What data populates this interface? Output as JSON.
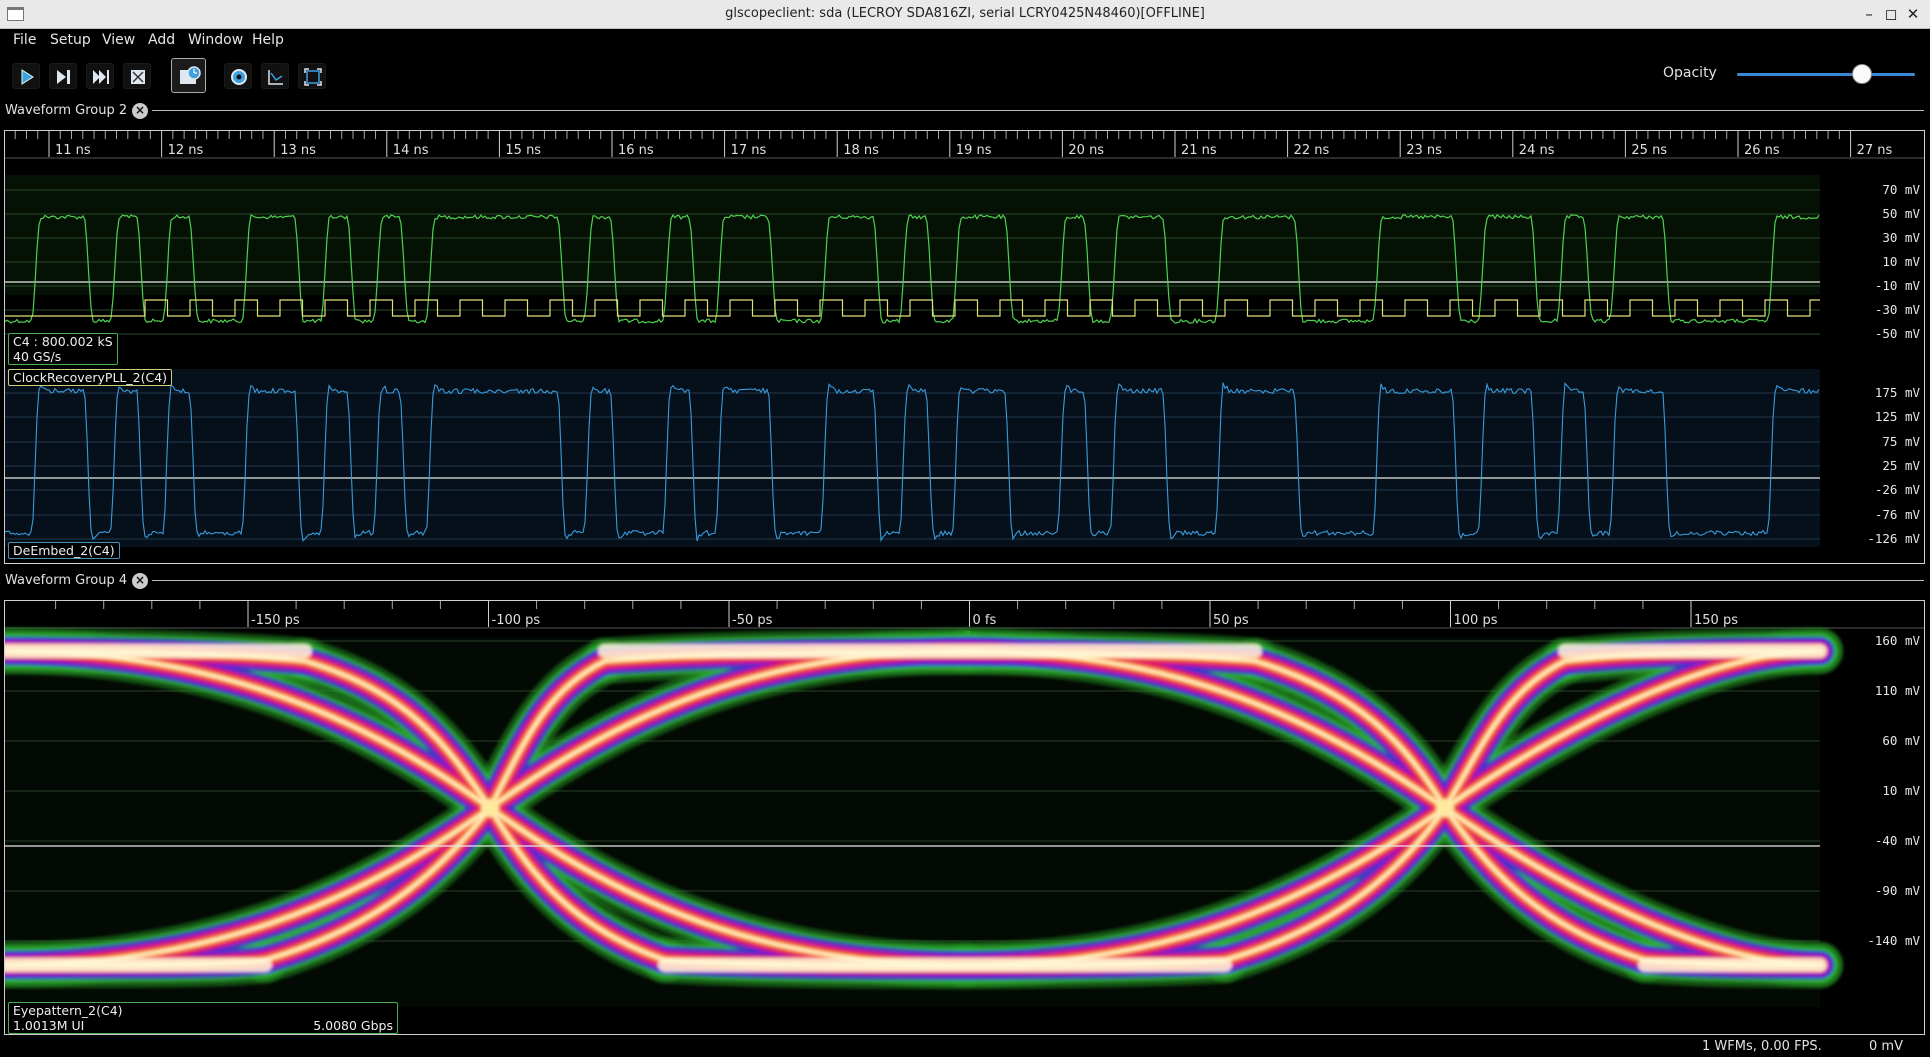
{
  "window": {
    "title": "glscopeclient: sda (LECROY SDA816ZI, serial LCRY0425N48460)[OFFLINE]",
    "minimize": "–",
    "maximize": "◻",
    "close": "✕"
  },
  "menu": [
    "File",
    "Setup",
    "View",
    "Add",
    "Window",
    "Help"
  ],
  "toolbar": {
    "buttons": [
      "start-trigger",
      "single-trigger",
      "force-trigger",
      "stop-trigger",
      "history",
      "refresh-settings",
      "clear-sweeps",
      "fullscreen"
    ],
    "opacity_label": "Opacity",
    "opacity_value": 0.7
  },
  "groups": [
    {
      "name": "Waveform Group 2",
      "close_glyph": "×",
      "time_ticks": [
        "11 ns",
        "12 ns",
        "13 ns",
        "14 ns",
        "15 ns",
        "16 ns",
        "17 ns",
        "18 ns",
        "19 ns",
        "20 ns",
        "21 ns",
        "22 ns",
        "23 ns",
        "24 ns",
        "25 ns",
        "26 ns",
        "27 ns"
      ],
      "channels": [
        {
          "name": "C4 : 800.002 kS",
          "info": "40 GS/s",
          "color": "#4fd14f",
          "yticks": [
            "70 mV",
            "50 mV",
            "30 mV",
            "10 mV",
            "-10 mV",
            "-30 mV",
            "-50 mV"
          ]
        },
        {
          "name": "ClockRecoveryPLL_2(C4)",
          "color": "#e0e07a"
        },
        {
          "name": "DeEmbed_2(C4)",
          "color": "#3a9bdc",
          "yticks": [
            "175 mV",
            "125 mV",
            "75 mV",
            "25 mV",
            "-26 mV",
            "-76 mV",
            "-126 mV"
          ]
        }
      ]
    },
    {
      "name": "Waveform Group 4",
      "close_glyph": "×",
      "time_ticks": [
        "-150 ps",
        "-100 ps",
        "-50 ps",
        "0 fs",
        "50 ps",
        "100 ps",
        "150 ps"
      ],
      "channels": [
        {
          "name": "Eyepattern_2(C4)",
          "ui_count": "1.0013M UI",
          "bitrate": "5.0080 Gbps",
          "yticks": [
            "160 mV",
            "110 mV",
            "60 mV",
            "10 mV",
            "-40 mV",
            "-90 mV",
            "-140 mV"
          ]
        }
      ]
    }
  ],
  "status": {
    "wfms": "1 WFMs, 0.00 FPS.",
    "cursor": "0 mV"
  },
  "colors": {
    "accent": "#3b88d9",
    "green_trace": "#4fd14f",
    "blue_trace": "#3a9bdc",
    "clock_trace": "#e0e07a"
  }
}
